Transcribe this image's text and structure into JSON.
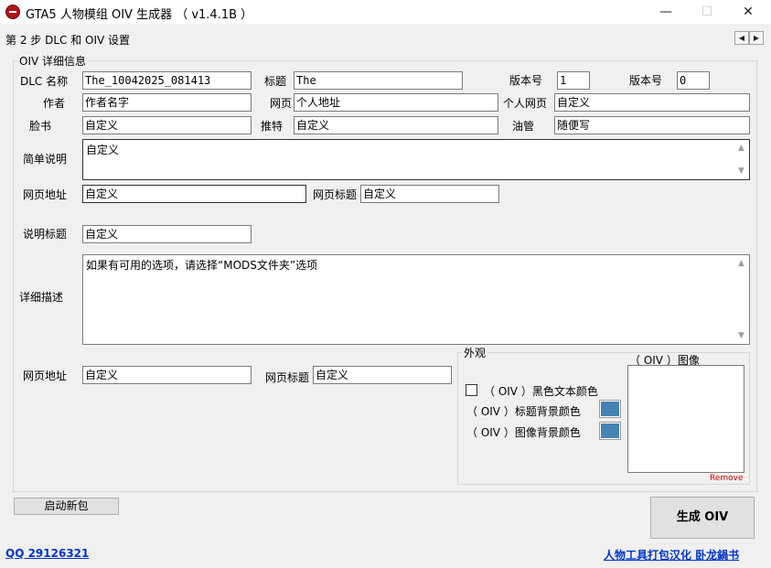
{
  "window": {
    "title": "GTA5 人物模组 OIV 生成器 （ v1.4.1B ）",
    "controls": {
      "minimize": "—",
      "maximize": "☐",
      "close": "✕"
    }
  },
  "step": {
    "label": "第 2 步 DLC 和 OIV 设置",
    "prev": "◀",
    "next": "▶"
  },
  "details": {
    "group_title": "OIV 详细信息",
    "dlc_name_label": "DLC 名称",
    "dlc_name_value": "The_10042025_081413",
    "title_label": "标题",
    "title_value": "The",
    "version_label_1": "版本号",
    "version_value_1": "1",
    "version_label_2": "版本号",
    "version_value_2": "0",
    "author_label": "作者",
    "author_value": "作者名字",
    "webpage_label": "网页",
    "webpage_value": "个人地址",
    "personal_page_label": "个人网页",
    "personal_page_value": "自定义",
    "facebook_label": "脸书",
    "facebook_value": "自定义",
    "twitter_label": "推特",
    "twitter_value": "自定义",
    "youtube_label": "油管",
    "youtube_value": "随便写",
    "brief_label": "简单说明",
    "brief_value": "自定义",
    "url_label_1": "网页地址",
    "url_value_1": "自定义",
    "url_title_label_1": "网页标题",
    "url_title_value_1": "自定义",
    "desc_title_label": "说明标题",
    "desc_title_value": "自定义",
    "detail_label": "详细描述",
    "detail_value": "如果有可用的选项，请选择“MODS文件夹”选项",
    "url_label_2": "网页地址",
    "url_value_2": "自定义",
    "url_title_label_2": "网页标题",
    "url_title_value_2": "自定义"
  },
  "appearance": {
    "group_title": "外观",
    "black_text_label": "（ OIV ）黑色文本颜色",
    "black_text_checked": false,
    "title_bg_label": "（ OIV ）标题背景颜色",
    "title_bg_color": "#4682b4",
    "image_bg_label": "（ OIV ）图像背景颜色",
    "image_bg_color": "#4682b4",
    "image_label": "（ OIV ）图像",
    "remove_label": "Remove"
  },
  "footer": {
    "new_package_button": "启动新包",
    "generate_button": "生成 OIV",
    "qq_link": "QQ 29126321",
    "credit_link": "人物工具打包汉化 卧龙鍋书"
  }
}
